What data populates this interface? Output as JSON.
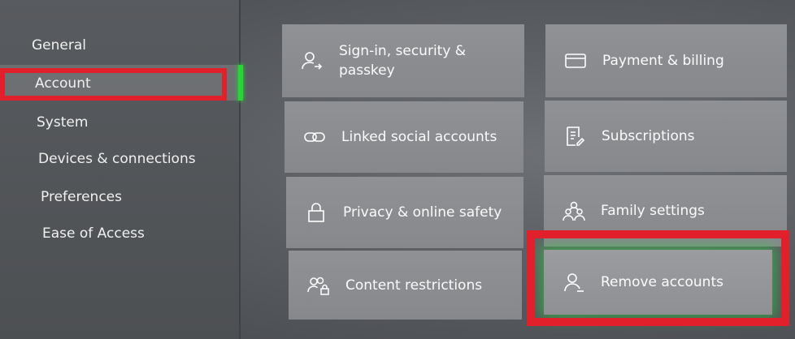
{
  "sidebar": {
    "items": [
      {
        "label": "General"
      },
      {
        "label": "Account"
      },
      {
        "label": "System"
      },
      {
        "label": "Devices & connections"
      },
      {
        "label": "Preferences"
      },
      {
        "label": "Ease of Access"
      }
    ],
    "selected": "Account"
  },
  "tiles": {
    "sign_in": "Sign-in, security & passkey",
    "payment": "Payment & billing",
    "linked_social": "Linked social accounts",
    "subscriptions": "Subscriptions",
    "privacy": "Privacy & online safety",
    "family": "Family settings",
    "content": "Content restrictions",
    "remove": "Remove accounts"
  },
  "icons": {
    "sign_in": "person-arrow-icon",
    "payment": "card-icon",
    "linked_social": "link-icon",
    "subscriptions": "document-edit-icon",
    "privacy": "lock-icon",
    "family": "family-icon",
    "content": "people-lock-icon",
    "remove": "person-minus-icon"
  },
  "colors": {
    "focus": "#27d632",
    "annotation": "#e2202b"
  }
}
